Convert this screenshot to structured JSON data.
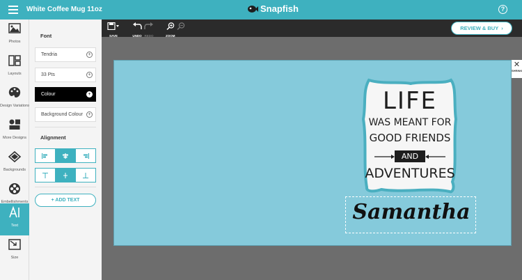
{
  "header": {
    "document_title": "White Coffee Mug 11oz",
    "brand": "Snapfish",
    "help_label": "?"
  },
  "left_nav": {
    "items": [
      {
        "label": "Photos",
        "icon": "photos-icon"
      },
      {
        "label": "Layouts",
        "icon": "layouts-icon"
      },
      {
        "label": "Design Variations",
        "icon": "palette-icon"
      },
      {
        "label": "More Designs",
        "icon": "more-designs-icon"
      },
      {
        "label": "Backgrounds",
        "icon": "backgrounds-icon"
      },
      {
        "label": "Embellishments",
        "icon": "embellishments-icon"
      },
      {
        "label": "Text",
        "icon": "text-icon",
        "active": true
      },
      {
        "label": "Size",
        "icon": "size-icon"
      }
    ]
  },
  "panel": {
    "font_heading": "Font",
    "fields": [
      {
        "label": "Tendria",
        "active": false
      },
      {
        "label": "33 Pts",
        "active": false
      },
      {
        "label": "Colour",
        "active": true
      },
      {
        "label": "Background Colour",
        "active": false
      }
    ],
    "alignment_heading": "Alignment",
    "horizontal_align_selected": "center",
    "vertical_align_selected": "middle",
    "add_text_label": "+ ADD TEXT"
  },
  "toolbar": {
    "save_label": "SAVE",
    "undo_label": "UNDO",
    "redo_label": "REDO",
    "zoom_label": "ZOOM",
    "review_label": "REVIEW & BUY"
  },
  "canvas": {
    "background_color": "#85cadb",
    "side_tab_label": "SHRINK",
    "quote_lines": [
      "LIFE",
      "WAS MEANT FOR",
      "GOOD FRIENDS",
      "AND",
      "ADVENTURES"
    ],
    "personalized_text": "Samantha"
  },
  "colors": {
    "accent": "#3eb1bf",
    "toolbar": "#2b2b2b",
    "workspace": "#6d6d6d"
  }
}
